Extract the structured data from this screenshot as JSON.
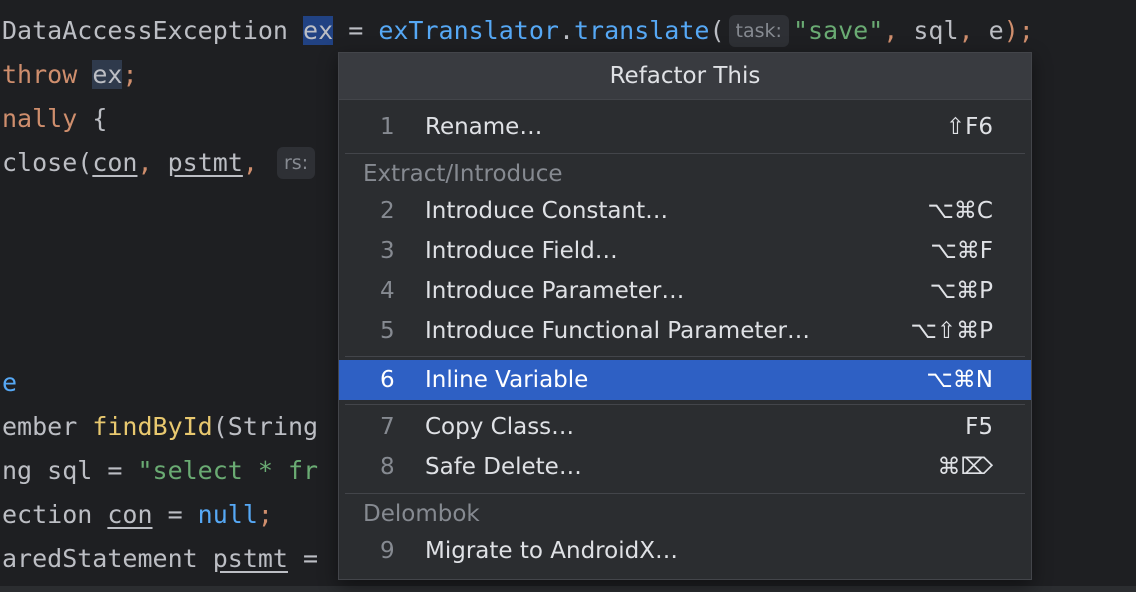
{
  "editor": {
    "line1": {
      "type": "DataAccessException",
      "var": "ex",
      "assign": " = ",
      "obj": "exTranslator",
      "dot": ".",
      "method": "translate",
      "paren": "(",
      "hint": "task:",
      "str": "\"save\"",
      "comma1": ",",
      "arg2": " sql",
      "comma2": ",",
      "arg3": " e",
      "end": ");"
    },
    "line2": {
      "kw": "throw",
      "space": " ",
      "var": "ex",
      "end": ";"
    },
    "line3": {
      "kw": "nally",
      "rest": " {"
    },
    "line4": {
      "fn": "close",
      "paren": "(",
      "a1": "con",
      "c1": ",",
      "sp1": " ",
      "a2": "pstmt",
      "c2": ",",
      "hint": "rs:"
    },
    "line5": {
      "text": "e"
    },
    "line6": {
      "type": "ember ",
      "fn": "findById",
      "rest": "(String"
    },
    "line7": {
      "type": "ng sql = ",
      "str": "\"select * fr"
    },
    "line8": {
      "type": "ection ",
      "var": "con",
      "assign": " = ",
      "kw": "null",
      "end": ";"
    },
    "line9": {
      "type": "aredStatement ",
      "var": "pstmt",
      "rest": " ="
    }
  },
  "popup": {
    "title": "Refactor This",
    "items": [
      {
        "num": "1",
        "label": "Rename…",
        "shortcut": "⇧F6"
      },
      {
        "num": "2",
        "label": "Introduce Constant…",
        "shortcut": "⌥⌘C"
      },
      {
        "num": "3",
        "label": "Introduce Field…",
        "shortcut": "⌥⌘F"
      },
      {
        "num": "4",
        "label": "Introduce Parameter…",
        "shortcut": "⌥⌘P"
      },
      {
        "num": "5",
        "label": "Introduce Functional Parameter…",
        "shortcut": "⌥⇧⌘P"
      },
      {
        "num": "6",
        "label": "Inline Variable",
        "shortcut": "⌥⌘N",
        "selected": true
      },
      {
        "num": "7",
        "label": "Copy Class…",
        "shortcut": "F5"
      },
      {
        "num": "8",
        "label": "Safe Delete…",
        "shortcut": "⌘⌦"
      },
      {
        "num": "9",
        "label": "Migrate to AndroidX…",
        "shortcut": ""
      }
    ],
    "groups": {
      "extract": "Extract/Introduce",
      "delombok": "Delombok"
    }
  },
  "colors": {
    "selection": "#2e60c4",
    "background": "#1e1f22",
    "popup": "#2b2d30"
  }
}
